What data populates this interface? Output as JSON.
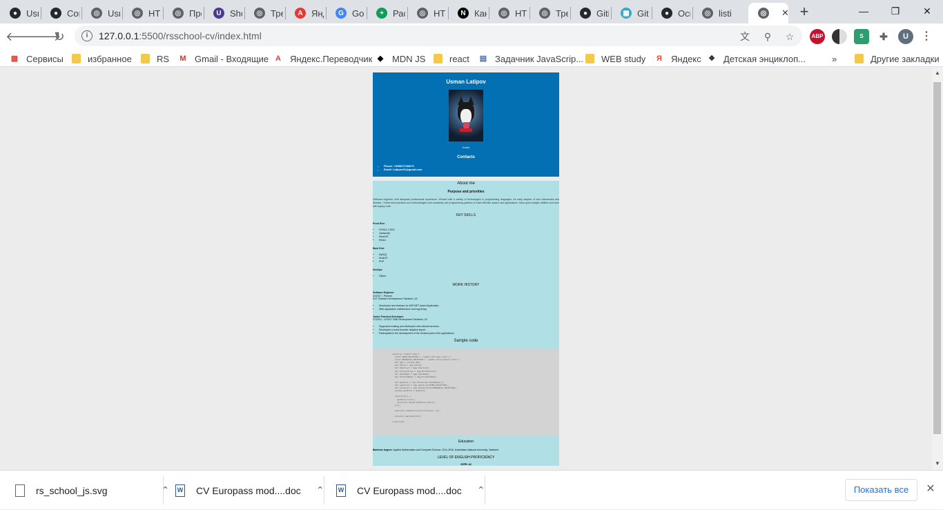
{
  "browser": {
    "tabs": [
      {
        "label": "Usn",
        "icon": "github-icon"
      },
      {
        "label": "Cor",
        "icon": "github-icon"
      },
      {
        "label": "Usn",
        "icon": "globe-icon"
      },
      {
        "label": "HTM",
        "icon": "globe-icon"
      },
      {
        "label": "Про",
        "icon": "globe-icon"
      },
      {
        "label": "Sho",
        "icon": "u-icon"
      },
      {
        "label": "Тре",
        "icon": "globe-icon"
      },
      {
        "label": "Янд",
        "icon": "translate-icon"
      },
      {
        "label": "Goc",
        "icon": "google-translate-icon"
      },
      {
        "label": "Рас",
        "icon": "plus-icon"
      },
      {
        "label": "HTM",
        "icon": "globe-icon"
      },
      {
        "label": "Как",
        "icon": "notion-icon"
      },
      {
        "label": "HTM",
        "icon": "globe-icon"
      },
      {
        "label": "Тре",
        "icon": "globe-icon"
      },
      {
        "label": "Giti",
        "icon": "github-icon"
      },
      {
        "label": "Git",
        "icon": "gitter-icon"
      },
      {
        "label": "Осн",
        "icon": "github-icon"
      },
      {
        "label": "listi",
        "icon": "globe-icon"
      }
    ],
    "window_controls": {
      "minimize": "—",
      "restore": "❐",
      "close": "✕"
    },
    "url_host": "127.0.0.1",
    "url_rest": ":5500/rsschool-cv/index.html",
    "extensions": {
      "abp": "ABP",
      "avatar": "U"
    },
    "bookmarks": [
      {
        "label": "Сервисы"
      },
      {
        "label": "избранное"
      },
      {
        "label": "RS"
      },
      {
        "label": "Gmail - Входящие"
      },
      {
        "label": "Яндекс.Переводчик"
      },
      {
        "label": "MDN JS"
      },
      {
        "label": "react"
      },
      {
        "label": "Задачник JavaScrip..."
      },
      {
        "label": "WEB study"
      },
      {
        "label": "Яндекс"
      },
      {
        "label": "Детская энциклоп..."
      }
    ],
    "bookmarks_more": "»",
    "other_bookmarks": "Другие закладки"
  },
  "cv": {
    "name": "Usman Latipov",
    "role": "Junior",
    "contacts_title": "Contacts",
    "contacts": [
      "Phone: +998972780670",
      "Email: Latipov01@gmail.com"
    ],
    "about_title": "About me",
    "purpose_title": "Purpose and priorities",
    "about_text": "Software engineer, with adequate professional experience. Worked with a variety of technologies in programming languages. An early adopter of new frameworks and libraries. I follow best practices and methodologies and constantly use programming patterns to build effective system and applications. Have good analytic abilities and work with legacy code.",
    "skills_title": "KEY SKILLS",
    "front_label": "Front End:",
    "front_items": [
      "HTML5, CSS3",
      "Javascript",
      "ReactJS",
      "Redux"
    ],
    "back_label": "Back End:",
    "back_items": [
      "MySQL",
      "NodeJS",
      "PHP"
    ],
    "devops_label": "DevOps:",
    "devops_items": [
      "Github"
    ],
    "work_title": "WORK HISTORY",
    "job1_title": "Software Engineer",
    "job1_dates": "01/2017 - Present",
    "job1_company": "EXT Software Development Tashkent, UZ",
    "job1_items": [
      "Developed new features for ASP.NET based Application.",
      "Web application maintenance and bug fixing"
    ],
    "job2_title": "Junior Frontend Developer",
    "job2_dates": "07/2015 - 12/2017 WBI Development Tashkent, UZ",
    "job2_items": [
      "Supported existing and developed new internal services.",
      "Developed a cross-browser adaptive layout",
      "Participated in the development of the frontend part of the applications"
    ],
    "code_title": "Sample code",
    "code": "<section class=\"code\">\n  const USER_SELECTOR = '[data-id=\"user-list\"]';\n  const PRODUCTS_SELECTOR = '[data-id=\"product-list\"]';\n  let App = window.App;\n  let Store = App.Store;\n  let UserList = App.UserList;\n  let ProductList = App.ProductList;\n  let UserRepo = App.UserRepo;\n  let ProductRepo = App.ProductRepo;\n\n  let myStore = new Store(new UserRepo());\n  let userList = new UserList(USER_SELECTOR);\n  let prodList = new ProductList(PRODUCTS_SELECTOR);\n  window.myStore = myStore;\n\n  (function() {\n    myStore.init();\n    userList.render(myStore.users);\n  })();\n\n  userList.onSelect(function(user) {});\n\n  console.log(userList);\n\n</section>",
    "education_title": "Education",
    "education_degree": "Bachelor degree:",
    "education_text": "Applied Mathematics and Computer Science, 2011-2015, Uzbekistan National University, Tashkent",
    "english_title": "LEVEL OF ENGLISH PROFICIENCY",
    "english_level": "CEFR: A2"
  },
  "downloads": {
    "items": [
      {
        "name": "rs_school_js.svg"
      },
      {
        "name": "CV Europass mod....doc"
      },
      {
        "name": "CV Europass mod....doc"
      }
    ],
    "show_all": "Показать все"
  },
  "colors": {
    "cv_header": "#0270b3",
    "cv_body": "#b0dfe5",
    "code_bg": "#d3d3d3"
  }
}
